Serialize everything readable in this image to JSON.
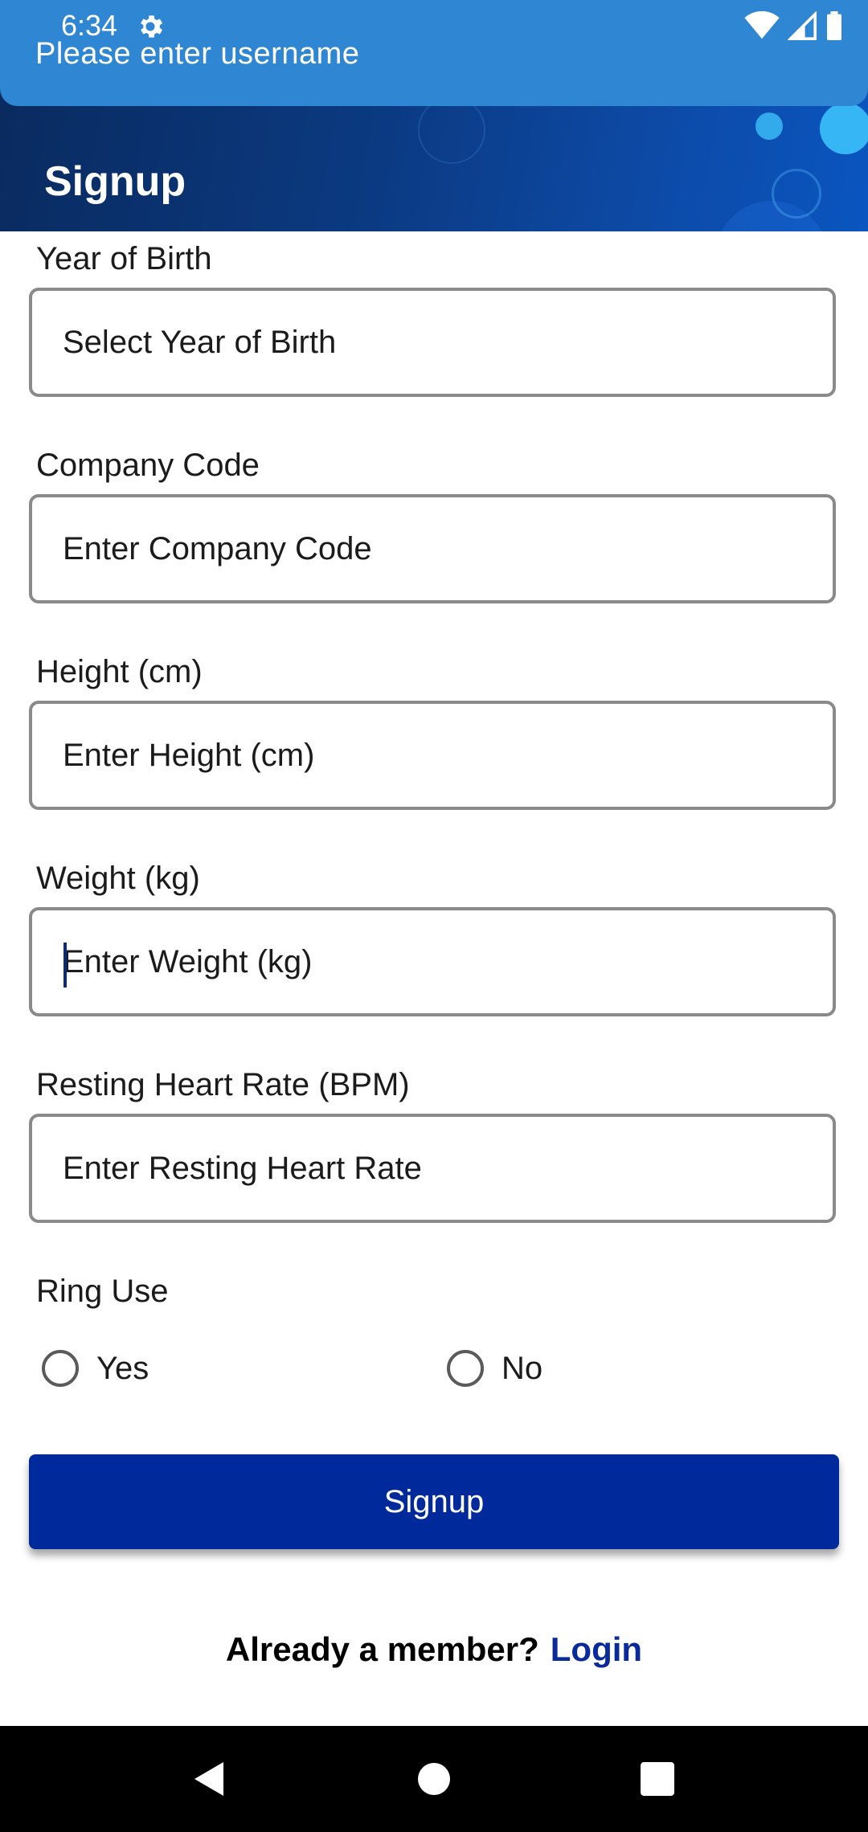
{
  "status_bar": {
    "time": "6:34",
    "icons": [
      "gear-icon",
      "wifi-icon",
      "signal-icon",
      "battery-icon"
    ]
  },
  "toast": {
    "message": "Please enter username"
  },
  "header": {
    "title": "Signup"
  },
  "form": {
    "year_of_birth": {
      "label": "Year of Birth",
      "placeholder": "Select Year of Birth"
    },
    "company_code": {
      "label": "Company Code",
      "placeholder": "Enter Company Code"
    },
    "height": {
      "label": "Height (cm)",
      "placeholder": "Enter Height (cm)"
    },
    "weight": {
      "label": "Weight (kg)",
      "placeholder": "Enter Weight (kg)"
    },
    "resting_heart_rate": {
      "label": "Resting Heart Rate (BPM)",
      "placeholder": "Enter Resting Heart Rate"
    },
    "ring_use": {
      "label": "Ring Use",
      "options": [
        "Yes",
        "No"
      ]
    },
    "submit_label": "Signup"
  },
  "footer": {
    "question": "Already a member?",
    "login_link": "Login"
  },
  "colors": {
    "status_strip": "#2f86d2",
    "primary_button": "#002a9c",
    "link": "#0b2a9a",
    "field_border": "#8a8a8a"
  }
}
